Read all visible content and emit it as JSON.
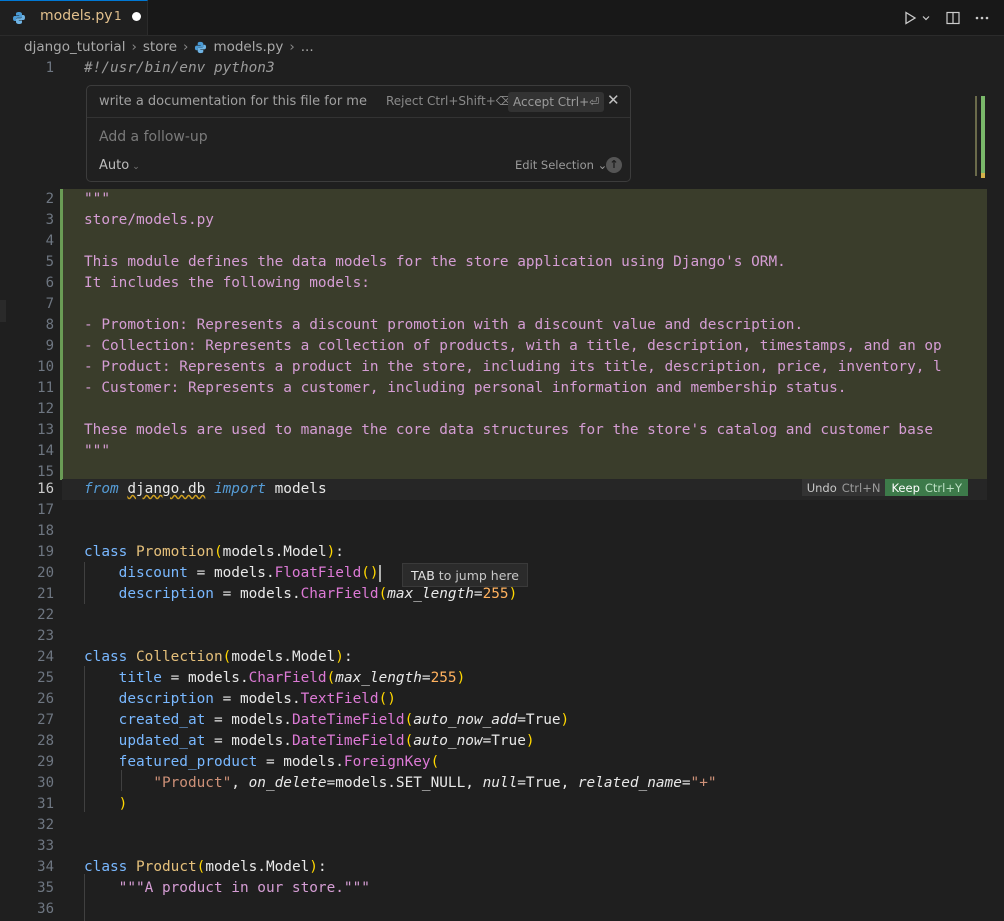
{
  "tab": {
    "filename": "models.py",
    "problem_count": "1"
  },
  "breadcrumb": [
    "django_tutorial",
    "store",
    "models.py",
    "..."
  ],
  "inline_chat": {
    "prompt": "write a documentation for this file for me",
    "reject_label": "Reject Ctrl+Shift+⌫",
    "accept_label": "Accept Ctrl+⏎",
    "followup_placeholder": "Add a follow-up",
    "mode": "Auto",
    "edit_selection": "Edit Selection"
  },
  "diff_actions": {
    "undo": "Undo",
    "undo_shortcut": "Ctrl+N",
    "keep": "Keep",
    "keep_shortcut": "Ctrl+Y"
  },
  "tab_hint": {
    "key": "TAB",
    "text": "to jump here"
  },
  "line_numbers": [
    "1",
    "2",
    "3",
    "4",
    "5",
    "6",
    "7",
    "8",
    "9",
    "10",
    "11",
    "12",
    "13",
    "14",
    "15",
    "16",
    "17",
    "18",
    "19",
    "20",
    "21",
    "22",
    "23",
    "24",
    "25",
    "26",
    "27",
    "28",
    "29",
    "30",
    "31",
    "32",
    "33",
    "34",
    "35",
    "36"
  ],
  "code": {
    "l1": "#!/usr/bin/env python3",
    "l2": "\"\"\"",
    "l3": "store/models.py",
    "l5": "This module defines the data models for the store application using Django's ORM.",
    "l6": "It includes the following models:",
    "l8": "- Promotion: Represents a discount promotion with a discount value and description.",
    "l9": "- Collection: Represents a collection of products, with a title, description, timestamps, and an op",
    "l10": "- Product: Represents a product in the store, including its title, description, price, inventory, l",
    "l11": "- Customer: Represents a customer, including personal information and membership status.",
    "l13": "These models are used to manage the core data structures for the store's catalog and customer base",
    "l14": "\"\"\"",
    "l16_from": "from",
    "l16_mod": "django.db",
    "l16_import": "import",
    "l16_name": "models",
    "cls_kw": "class",
    "promotion": "Promotion",
    "collection": "Collection",
    "product": "Product",
    "models_model": "models.Model",
    "discount": "discount",
    "description": "description",
    "title": "title",
    "created_at": "created_at",
    "updated_at": "updated_at",
    "featured_product": "featured_product",
    "eq_models": " = models.",
    "floatfield": "FloatField",
    "charfield": "CharField",
    "textfield": "TextField",
    "datetimefield": "DateTimeField",
    "foreignkey": "ForeignKey",
    "max_length": "max_length",
    "v255": "255",
    "auto_now_add": "auto_now_add",
    "auto_now": "auto_now",
    "true": "True",
    "product_str": "\"Product\"",
    "on_delete": "on_delete",
    "set_null": "models.SET_NULL",
    "null": "null",
    "related_name": "related_name",
    "plus_str": "\"+\"",
    "l35": "\"\"\"A product in our store.\"\"\""
  }
}
